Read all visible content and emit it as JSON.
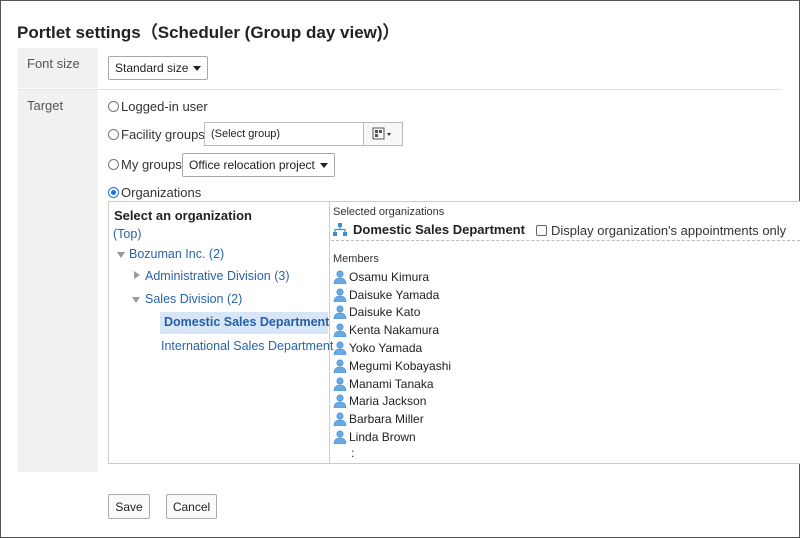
{
  "page": {
    "title": "Portlet settings（Scheduler (Group day view)）"
  },
  "font_size": {
    "label": "Font size",
    "value": "Standard size"
  },
  "target": {
    "label": "Target",
    "options": {
      "logged_in": "Logged-in user",
      "facility": "Facility groups",
      "my_groups": "My groups",
      "organizations": "Organizations"
    },
    "facility_value": "(Select group)",
    "my_groups_value": "Office relocation project"
  },
  "org_tree": {
    "heading": "Select an organization",
    "top": "(Top)",
    "nodes": [
      {
        "label": "Bozuman Inc. (2)"
      },
      {
        "label": "Administrative Division (3)"
      },
      {
        "label": "Sales Division (2)"
      },
      {
        "label": "Domestic Sales Department"
      },
      {
        "label": "International Sales Department"
      }
    ]
  },
  "selection": {
    "label": "Selected organizations",
    "org": "Domestic Sales Department",
    "checkbox_label": "Display organization's appointments only",
    "members_label": "Members",
    "members": [
      "Osamu Kimura",
      "Daisuke Yamada",
      "Daisuke Kato",
      "Kenta Nakamura",
      "Yoko Yamada",
      "Megumi Kobayashi",
      "Manami Tanaka",
      "Maria Jackson",
      "Barbara Miller",
      "Linda Brown"
    ],
    "more": ":"
  },
  "buttons": {
    "save": "Save",
    "cancel": "Cancel"
  },
  "colors": {
    "link": "#2a63a8",
    "selected_bg": "#d6e6f7",
    "label_bg": "#f1f1f1",
    "icon_blue": "#3f8fd4"
  }
}
